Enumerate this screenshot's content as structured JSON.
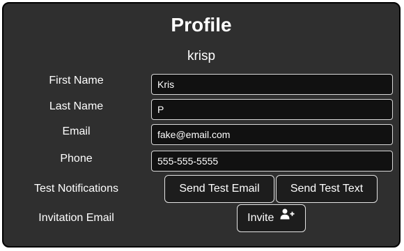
{
  "profile": {
    "title": "Profile",
    "username": "krisp"
  },
  "fields": {
    "first_name": {
      "label": "First Name",
      "value": "Kris"
    },
    "last_name": {
      "label": "Last Name",
      "value": "P"
    },
    "email": {
      "label": "Email",
      "value": "fake@email.com"
    },
    "phone": {
      "label": "Phone",
      "value": "555-555-5555"
    }
  },
  "notifications": {
    "label": "Test Notifications",
    "send_test_email": "Send Test Email",
    "send_test_text": "Send Test Text"
  },
  "invitation": {
    "label": "Invitation Email",
    "invite_button": "Invite",
    "invite_icon": "add-user-icon"
  },
  "colors": {
    "panel_background": "#2f2f2f",
    "input_background": "#111111",
    "button_background": "#1d1d1d",
    "text": "#ffffff",
    "border": "#d9d9d9"
  }
}
